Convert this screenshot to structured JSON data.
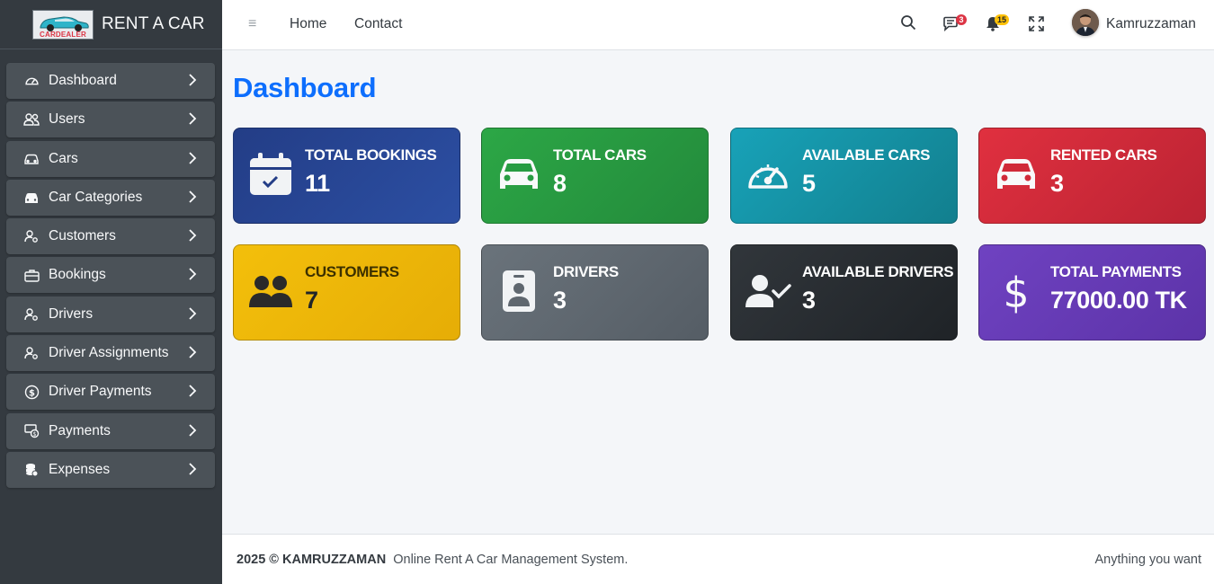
{
  "brand": {
    "name": "RENT A CAR",
    "logo_text": "CARDEALER"
  },
  "sidebar": {
    "items": [
      {
        "label": "Dashboard",
        "icon": "speedometer-icon"
      },
      {
        "label": "Users",
        "icon": "people-icon"
      },
      {
        "label": "Cars",
        "icon": "car-icon"
      },
      {
        "label": "Car Categories",
        "icon": "car-front-icon"
      },
      {
        "label": "Customers",
        "icon": "person-gear-icon"
      },
      {
        "label": "Bookings",
        "icon": "briefcase-icon"
      },
      {
        "label": "Drivers",
        "icon": "person-gear-icon"
      },
      {
        "label": "Driver Assignments",
        "icon": "person-gear-icon"
      },
      {
        "label": "Driver Payments",
        "icon": "dollar-circle-icon"
      },
      {
        "label": "Payments",
        "icon": "cash-coin-icon"
      },
      {
        "label": "Expenses",
        "icon": "coins-stack-icon"
      }
    ]
  },
  "topbar": {
    "links": [
      "Home",
      "Contact"
    ],
    "messages_count": "3",
    "notifications_count": "15",
    "username": "Kamruzzaman"
  },
  "page": {
    "title": "Dashboard"
  },
  "cards": [
    {
      "label": "TOTAL BOOKINGS",
      "value": "11",
      "icon": "calendar-check-icon",
      "color": "#233d86"
    },
    {
      "label": "TOTAL CARS",
      "value": "8",
      "icon": "car-front-icon",
      "color": "#2ca746"
    },
    {
      "label": "AVAILABLE CARS",
      "value": "5",
      "icon": "speedometer-icon",
      "color": "#18a2b8"
    },
    {
      "label": "RENTED CARS",
      "value": "3",
      "icon": "car-front-icon",
      "color": "#dc3545"
    },
    {
      "label": "CUSTOMERS",
      "value": "7",
      "icon": "people-fill-icon",
      "color": "#f3bf0b"
    },
    {
      "label": "DRIVERS",
      "value": "3",
      "icon": "person-badge-icon",
      "color": "#6c757d"
    },
    {
      "label": "AVAILABLE DRIVERS",
      "value": "3",
      "icon": "person-check-icon",
      "color": "#2b3035"
    },
    {
      "label": "TOTAL PAYMENTS",
      "value": "77000.00 TK",
      "icon": "dollar-icon",
      "color": "#6f42c1"
    }
  ],
  "footer": {
    "copyright": "2025 © KAMRUZZAMAN",
    "tagline": "Online Rent A Car Management System.",
    "right_text": "Anything you want"
  }
}
